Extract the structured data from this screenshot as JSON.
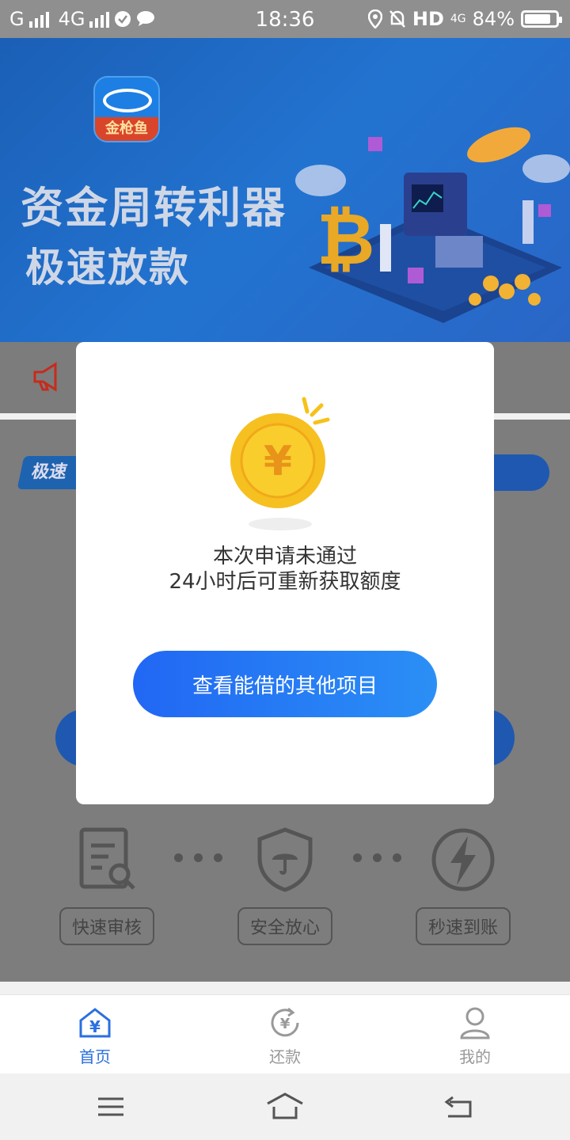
{
  "status_bar": {
    "carrier": "G",
    "network": "4G",
    "time": "18:36",
    "hd": "HD",
    "net2": "4G",
    "battery": "84%",
    "battery_level": 0.84
  },
  "banner": {
    "logo_text": "金枪鱼",
    "slogan_line1": "资金周转利器",
    "slogan_line2": "极速放款"
  },
  "underlay": {
    "tag_label": "极速",
    "features": [
      {
        "label": "快速审核",
        "icon": "document-search-icon"
      },
      {
        "label": "安全放心",
        "icon": "shield-umbrella-icon"
      },
      {
        "label": "秒速到账",
        "icon": "lightning-icon"
      }
    ]
  },
  "modal": {
    "coin_icon": "yen-coin-icon",
    "line1": "本次申请未通过",
    "line2": "24小时后可重新获取额度",
    "button_label": "查看能借的其他项目"
  },
  "tabbar": {
    "items": [
      {
        "label": "首页",
        "icon": "home-yen-icon",
        "active": true
      },
      {
        "label": "还款",
        "icon": "repay-icon",
        "active": false
      },
      {
        "label": "我的",
        "icon": "user-icon",
        "active": false
      }
    ]
  },
  "navbar": {
    "icons": [
      "menu-icon",
      "home-nav-icon",
      "back-icon"
    ]
  },
  "colors": {
    "accent": "#2a6fe0",
    "button_gradient_start": "#2167f4",
    "button_gradient_end": "#2b8ff5",
    "banner_blue": "#2273d0"
  }
}
